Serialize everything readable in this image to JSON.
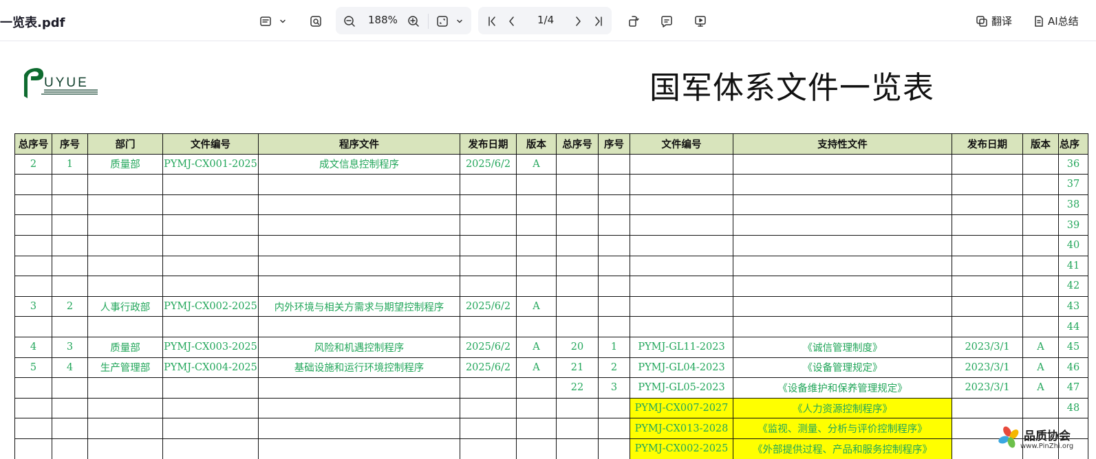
{
  "toolbar": {
    "filename": "一览表.pdf",
    "zoom": "188%",
    "page_indicator": "1/4",
    "translate_label": "翻译",
    "ai_label": "AI总结",
    "icons": [
      "layout-icon",
      "search-doc-icon",
      "zoom-out-icon",
      "zoom-in-icon",
      "fit-page-icon",
      "first-page-icon",
      "prev-page-icon",
      "next-page-icon",
      "last-page-icon",
      "rotate-icon",
      "comment-icon",
      "present-icon",
      "translate-icon",
      "ai-summary-icon"
    ]
  },
  "document": {
    "logo_text": "UYUE",
    "title": "国军体系文件一览表",
    "headers": [
      "总序号",
      "序号",
      "部门",
      "文件编号",
      "程序文件",
      "发布日期",
      "版本",
      "总序号",
      "序号",
      "文件编号",
      "支持性文件",
      "发布日期",
      "版本",
      "总序"
    ],
    "rows": [
      [
        "2",
        "1",
        "质量部",
        "PYMJ-CX001-2025",
        "成文信息控制程序",
        "2025/6/2",
        "A",
        "",
        "",
        "",
        "",
        "",
        "",
        "36"
      ],
      [
        "",
        "",
        "",
        "",
        "",
        "",
        "",
        "",
        "",
        "",
        "",
        "",
        "",
        "37"
      ],
      [
        "",
        "",
        "",
        "",
        "",
        "",
        "",
        "",
        "",
        "",
        "",
        "",
        "",
        "38"
      ],
      [
        "",
        "",
        "",
        "",
        "",
        "",
        "",
        "",
        "",
        "",
        "",
        "",
        "",
        "39"
      ],
      [
        "",
        "",
        "",
        "",
        "",
        "",
        "",
        "",
        "",
        "",
        "",
        "",
        "",
        "40"
      ],
      [
        "",
        "",
        "",
        "",
        "",
        "",
        "",
        "",
        "",
        "",
        "",
        "",
        "",
        "41"
      ],
      [
        "",
        "",
        "",
        "",
        "",
        "",
        "",
        "",
        "",
        "",
        "",
        "",
        "",
        "42"
      ],
      [
        "3",
        "2",
        "人事行政部",
        "PYMJ-CX002-2025",
        "内外环境与相关方需求与期望控制程序",
        "2025/6/2",
        "A",
        "",
        "",
        "",
        "",
        "",
        "",
        "43"
      ],
      [
        "",
        "",
        "",
        "",
        "",
        "",
        "",
        "",
        "",
        "",
        "",
        "",
        "",
        "44"
      ],
      [
        "4",
        "3",
        "质量部",
        "PYMJ-CX003-2025",
        "风险和机遇控制程序",
        "2025/6/2",
        "A",
        "20",
        "1",
        "PYMJ-GL11-2023",
        "《诚信管理制度》",
        "2023/3/1",
        "A",
        "45"
      ],
      [
        "5",
        "4",
        "生产管理部",
        "PYMJ-CX004-2025",
        "基础设施和运行环境控制程序",
        "2025/6/2",
        "A",
        "21",
        "2",
        "PYMJ-GL04-2023",
        "《设备管理规定》",
        "2023/3/1",
        "A",
        "46"
      ],
      [
        "",
        "",
        "",
        "",
        "",
        "",
        "",
        "22",
        "3",
        "PYMJ-GL05-2023",
        "《设备维护和保养管理规定》",
        "2023/3/1",
        "A",
        "47"
      ],
      [
        "",
        "",
        "",
        "",
        "",
        "",
        "",
        "",
        "",
        "PYMJ-CX007-2027",
        "《人力资源控制程序》",
        "",
        "",
        "48"
      ],
      [
        "",
        "",
        "",
        "",
        "",
        "",
        "",
        "",
        "",
        "PYMJ-CX013-2028",
        "《监视、测量、分析与评价控制程序》",
        "",
        "",
        ""
      ],
      [
        "",
        "",
        "",
        "",
        "",
        "",
        "",
        "",
        "",
        "PYMJ-CX002-2025",
        "《外部提供过程、产品和服务控制程序》",
        "",
        "",
        ""
      ]
    ],
    "highlighted_rows": [
      12,
      13,
      14
    ]
  },
  "watermark": {
    "text": "品质协会",
    "sub": "www.PinZhi.org"
  },
  "colors": {
    "header_bg": "#d8e4bc",
    "text_green": "#22a65a",
    "highlight": "#ffff00",
    "logo_green": "#0e6b2f"
  }
}
